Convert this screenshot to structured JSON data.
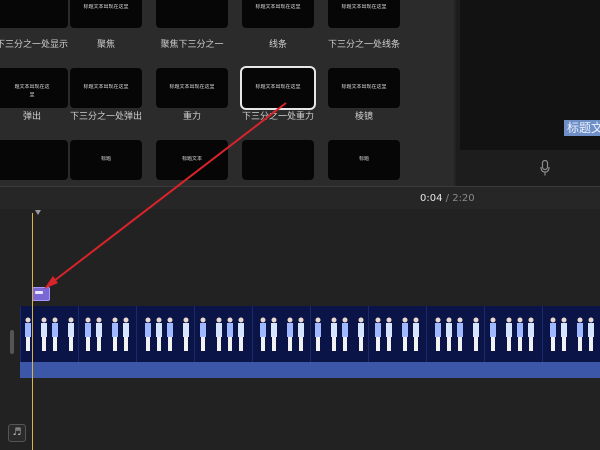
{
  "browser": {
    "titles": [
      {
        "name": "tile-lower-third-show",
        "label": "下三分之一处显示",
        "preview": [
          "",
          ""
        ]
      },
      {
        "name": "tile-focus",
        "label": "聚焦",
        "preview": [
          "标题文本出现在这里",
          ""
        ]
      },
      {
        "name": "tile-focus-lower-third",
        "label": "聚焦下三分之一",
        "preview": [
          "",
          ""
        ]
      },
      {
        "name": "tile-line",
        "label": "线条",
        "preview": [
          "标题文本出现在这里",
          ""
        ]
      },
      {
        "name": "tile-lower-third-line",
        "label": "下三分之一处线条",
        "preview": [
          "标题文本出现在这里",
          ""
        ]
      },
      {
        "name": "tile-popup",
        "label": "弹出",
        "preview": [
          "题文本出现在这",
          "里"
        ]
      },
      {
        "name": "tile-lower-third-popup",
        "label": "下三分之一处弹出",
        "preview": [
          "标题文本出现在这里",
          ""
        ]
      },
      {
        "name": "tile-gravity",
        "label": "重力",
        "preview": [
          "标题文本出现在这里",
          ""
        ]
      },
      {
        "name": "tile-lower-third-gravity",
        "label": "下三分之一处重力",
        "preview": [
          "标题文本出现在这里",
          ""
        ]
      },
      {
        "name": "tile-prism",
        "label": "棱镜",
        "preview": [
          "标题文本出现在这里",
          ""
        ]
      },
      {
        "name": "tile-row3-1",
        "label": "",
        "preview": [
          "",
          ""
        ]
      },
      {
        "name": "tile-row3-2",
        "label": "",
        "preview": [
          "标题",
          ""
        ]
      },
      {
        "name": "tile-row3-3",
        "label": "",
        "preview": [
          "标题文本",
          ""
        ]
      },
      {
        "name": "tile-row3-4",
        "label": "",
        "preview": [
          "",
          ""
        ]
      },
      {
        "name": "tile-row3-5",
        "label": "",
        "preview": [
          "标题",
          ""
        ]
      }
    ],
    "selected_index": 8
  },
  "viewer": {
    "overlay_text": "标题文本"
  },
  "timecode": {
    "current": "0:04",
    "separator": " / ",
    "duration": "2:20"
  },
  "icons": {
    "mic": "microphone-icon",
    "music": "music-note-icon",
    "playhead_marker": "playhead-marker-icon"
  },
  "colors": {
    "accent_playhead": "#d9b44a",
    "title_clip": "#7a67d6",
    "video_track": "#08113a",
    "audio_band": "#3d57a8",
    "annotation_arrow": "#d8232a"
  }
}
